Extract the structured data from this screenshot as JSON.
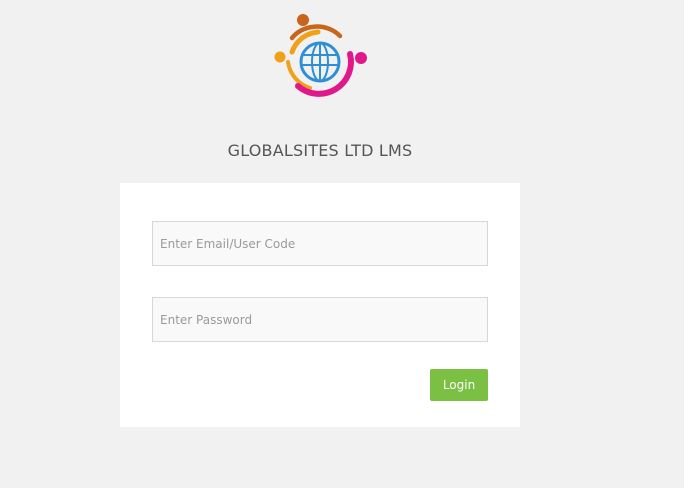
{
  "app": {
    "title": "GLOBALSITES LTD LMS"
  },
  "form": {
    "email_placeholder": "Enter Email/User Code",
    "email_value": "",
    "password_placeholder": "Enter Password",
    "password_value": "",
    "login_label": "Login"
  },
  "icons": {
    "logo": "globe-people-logo-icon"
  },
  "colors": {
    "page_background": "#f1f1f1",
    "card_background": "#ffffff",
    "login_button": "#7cc043",
    "logo_orange": "#f0a019",
    "logo_brown": "#c8651a",
    "logo_magenta": "#e0188a",
    "logo_blue": "#2f8fd6"
  }
}
